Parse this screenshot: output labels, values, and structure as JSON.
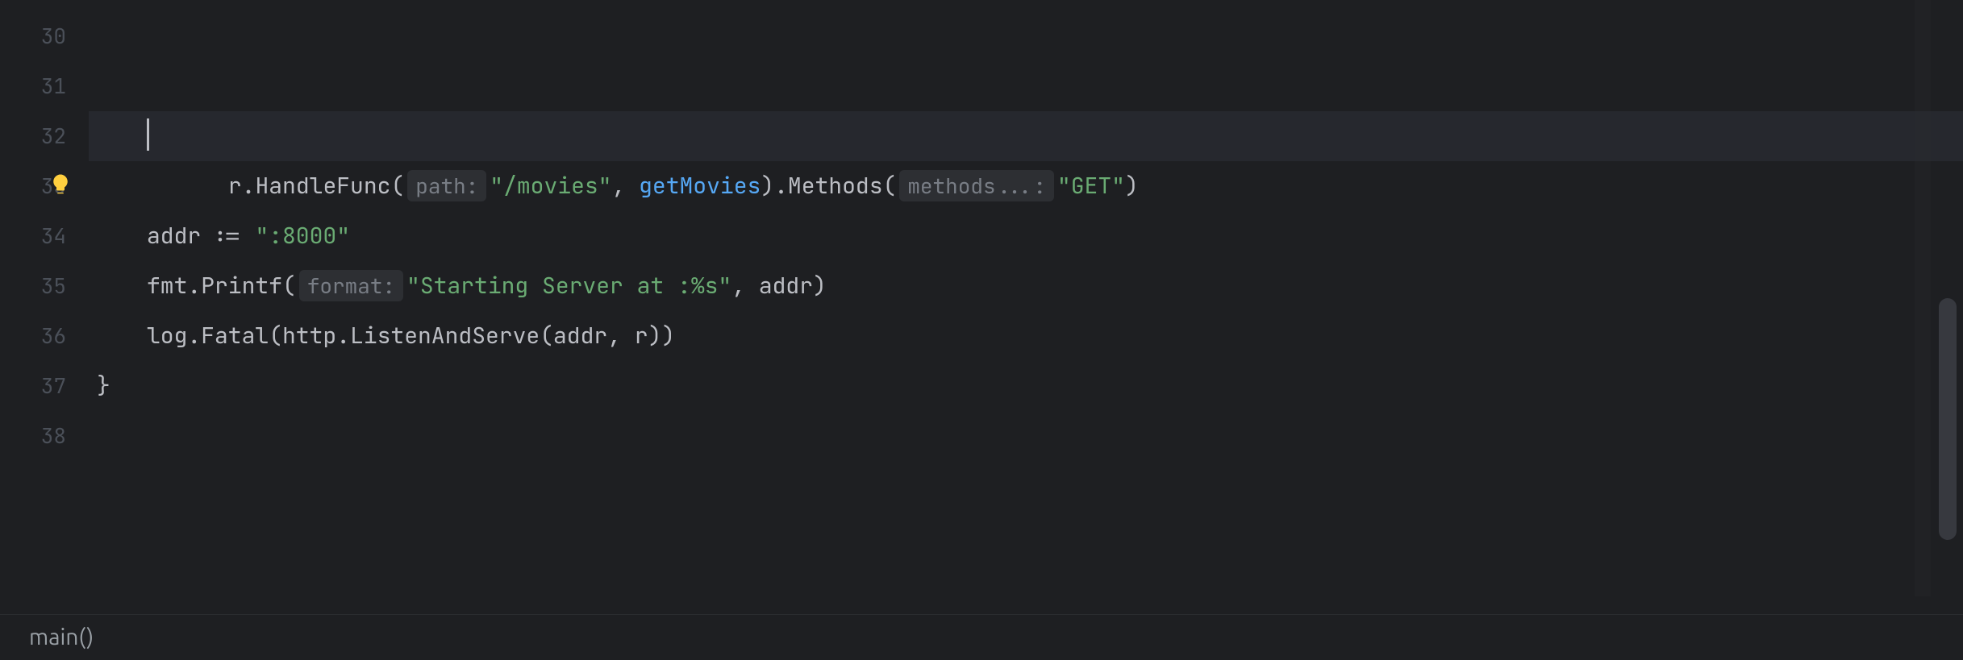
{
  "gutter": {
    "start": 30,
    "end": 38,
    "lines": [
      "30",
      "31",
      "32",
      "33",
      "34",
      "35",
      "36",
      "37",
      "38"
    ]
  },
  "hints": {
    "path": "path:",
    "methods": "methods...:",
    "format": "format:"
  },
  "code": {
    "l31": {
      "pre": "r.HandleFunc(",
      "func": "HandleFunc",
      "path_str": "\"/movies\"",
      "comma1": ", ",
      "getMovies": "getMovies",
      "after_gm": ").Methods(",
      "methods_str": "\"GET\"",
      "close": ")"
    },
    "l34": {
      "text_pre": "addr := ",
      "str": "\":8000\""
    },
    "l35": {
      "pre": "fmt.Printf(",
      "str": "\"Starting Server at :%s\"",
      "post": ", addr)"
    },
    "l36": "log.Fatal(http.ListenAndServe(addr, r))",
    "l37": "}"
  },
  "breadcrumb": "main()",
  "icons": {
    "bulb": "lightbulb-icon"
  }
}
